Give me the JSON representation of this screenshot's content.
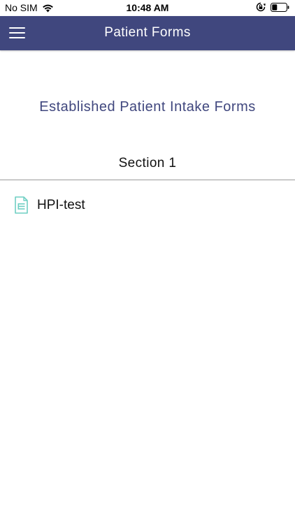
{
  "status_bar": {
    "carrier": "No SIM",
    "time": "10:48 AM",
    "icons": [
      "wifi-icon",
      "lock-rotation-icon",
      "battery-icon"
    ]
  },
  "nav": {
    "title": "Patient Forms",
    "menu_icon": "hamburger-menu-icon",
    "background_color": "#40477e"
  },
  "main": {
    "heading": "Established Patient Intake Forms",
    "sections": [
      {
        "title": "Section 1",
        "forms": [
          {
            "name": "HPI-test",
            "icon": "document-icon"
          }
        ]
      }
    ]
  },
  "colors": {
    "accent": "#40477e",
    "icon_tint": "#6fcfc3"
  }
}
